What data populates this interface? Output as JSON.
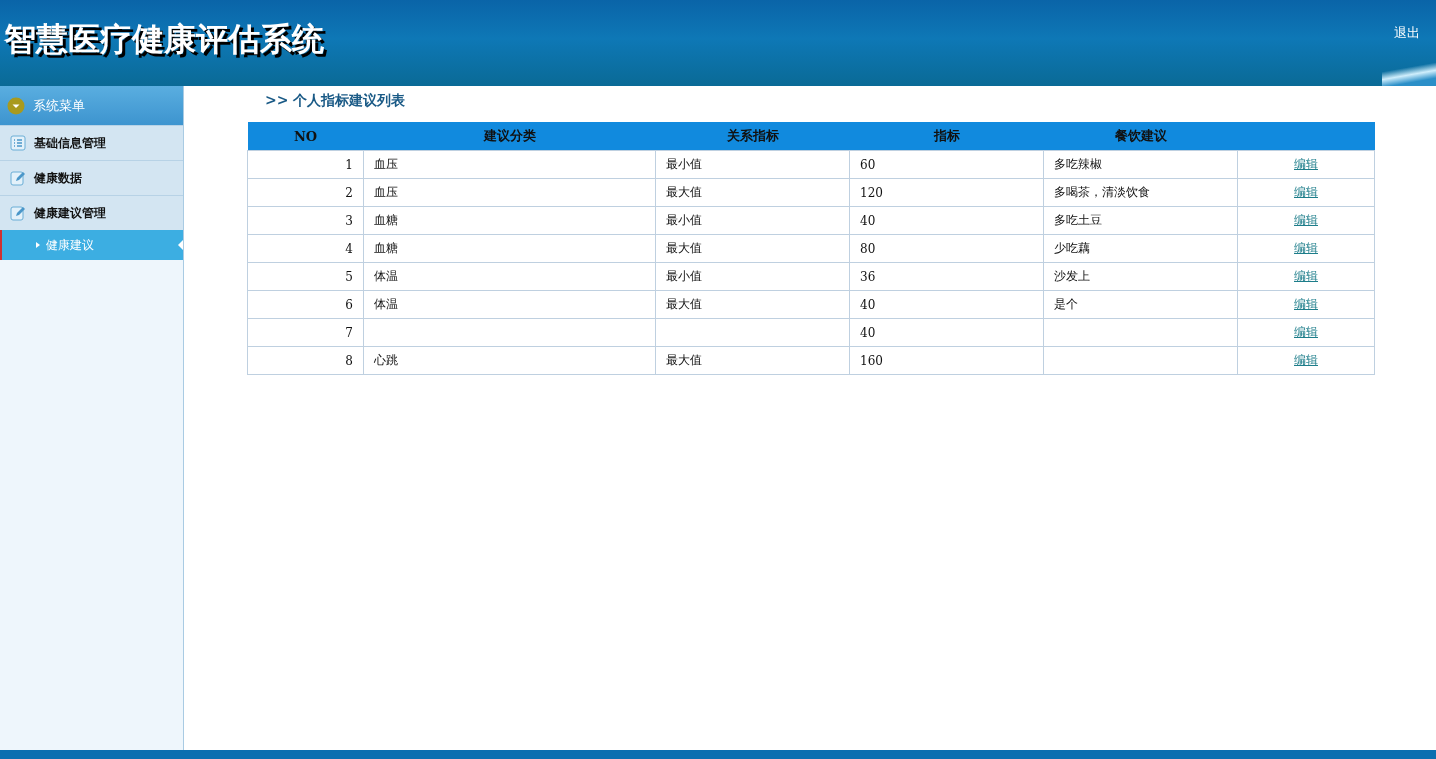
{
  "header": {
    "title": "智慧医疗健康评估系统",
    "logout": "退出"
  },
  "sidebar": {
    "title": "系统菜单",
    "items": [
      {
        "label": "基础信息管理",
        "selected": false
      },
      {
        "label": "健康数据",
        "selected": false
      },
      {
        "label": "健康建议管理",
        "selected": false,
        "expanded": true,
        "children": [
          {
            "label": "健康建议",
            "selected": true
          }
        ]
      }
    ]
  },
  "content": {
    "title": ">> 个人指标建议列表"
  },
  "table": {
    "columns": [
      "NO",
      "建议分类",
      "关系指标",
      "指标",
      "餐饮建议"
    ],
    "rows": [
      {
        "no": "1",
        "category": "血压",
        "relation": "最小值",
        "value": "60",
        "advice": "多吃辣椒",
        "action": "编辑"
      },
      {
        "no": "2",
        "category": "血压",
        "relation": "最大值",
        "value": "120",
        "advice": "多喝茶，清淡饮食",
        "action": "编辑"
      },
      {
        "no": "3",
        "category": "血糖",
        "relation": "最小值",
        "value": "40",
        "advice": "多吃土豆",
        "action": "编辑"
      },
      {
        "no": "4",
        "category": "血糖",
        "relation": "最大值",
        "value": "80",
        "advice": "少吃藕",
        "action": "编辑"
      },
      {
        "no": "5",
        "category": "体温",
        "relation": "最小值",
        "value": "36",
        "advice": "沙发上",
        "action": "编辑"
      },
      {
        "no": "6",
        "category": "体温",
        "relation": "最大值",
        "value": "40",
        "advice": "是个",
        "action": "编辑"
      },
      {
        "no": "7",
        "value": "40",
        "action": "编辑"
      },
      {
        "no": "8",
        "category": "心跳",
        "relation": "最大值",
        "value": "160",
        "action": "编辑"
      }
    ]
  }
}
